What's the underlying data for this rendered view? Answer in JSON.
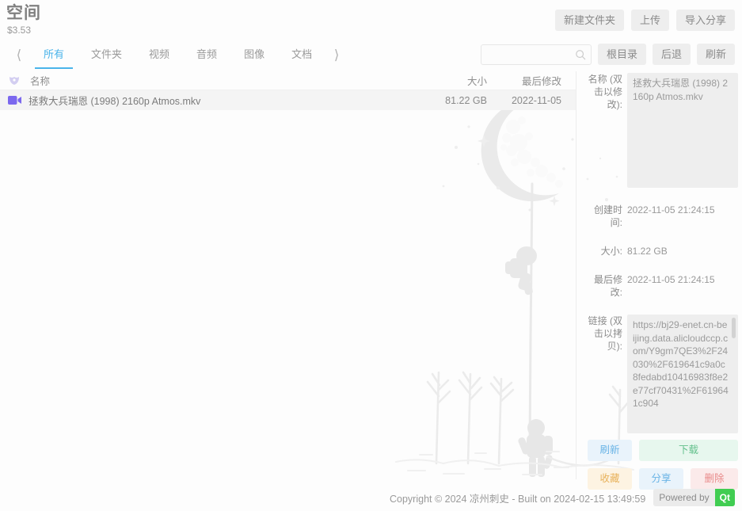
{
  "header": {
    "title": "空间",
    "quota": "$3.53",
    "actions": [
      {
        "label": "新建文件夹",
        "name": "new-folder-button"
      },
      {
        "label": "上传",
        "name": "upload-button"
      },
      {
        "label": "导入分享",
        "name": "import-share-button"
      }
    ]
  },
  "tabbar": {
    "prev_icon": "chevron-left-icon",
    "next_icon": "chevron-right-icon",
    "tabs": [
      {
        "label": "所有",
        "active": true
      },
      {
        "label": "文件夹",
        "active": false
      },
      {
        "label": "视频",
        "active": false
      },
      {
        "label": "音频",
        "active": false
      },
      {
        "label": "图像",
        "active": false
      },
      {
        "label": "文档",
        "active": false
      }
    ],
    "search": {
      "value": "",
      "placeholder": ""
    },
    "nav_buttons": [
      {
        "label": "根目录",
        "name": "root-dir-button"
      },
      {
        "label": "后退",
        "name": "back-button"
      },
      {
        "label": "刷新",
        "name": "refresh-list-button"
      }
    ]
  },
  "list": {
    "columns": {
      "name": "名称",
      "size": "大小",
      "mtime": "最后修改"
    },
    "rows": [
      {
        "name": "拯救大兵瑞恩 (1998) 2160p Atmos.mkv",
        "size": "81.22 GB",
        "mtime": "2022-11-05",
        "icon": "video-file-icon"
      }
    ]
  },
  "detail": {
    "name_label": "名称 (双击以修改):",
    "name_value": "拯救大兵瑞恩 (1998) 2160p Atmos.mkv",
    "created_label": "创建时间:",
    "created_value": "2022-11-05 21:24:15",
    "size_label": "大小:",
    "size_value": "81.22 GB",
    "modified_label": "最后修改:",
    "modified_value": "2022-11-05 21:24:15",
    "link_label": "链接 (双击以拷贝):",
    "link_value": "https://bj29-enet.cn-beijing.data.alicloudccp.com/Y9gm7QE3%2F24030%2F619641c9a0c8fedabd10416983f8e2e77cf70431%2F619641c904",
    "buttons": {
      "refresh": "刷新",
      "download": "下载",
      "favorite": "收藏",
      "share": "分享",
      "delete": "删除"
    }
  },
  "footer": {
    "copyright": "Copyright © 2024 凉州刺史 - Built on 2024-02-15 13:49:59",
    "powered_label": "Powered by",
    "powered_brand": "Qt"
  },
  "colors": {
    "accent_blue": "#4ab4ea",
    "qt_green": "#41cd52",
    "file_icon_purple": "#7b68ee",
    "download_green": "#63c08c",
    "delete_red": "#e98b8b",
    "favorite_orange": "#e8b25c"
  }
}
